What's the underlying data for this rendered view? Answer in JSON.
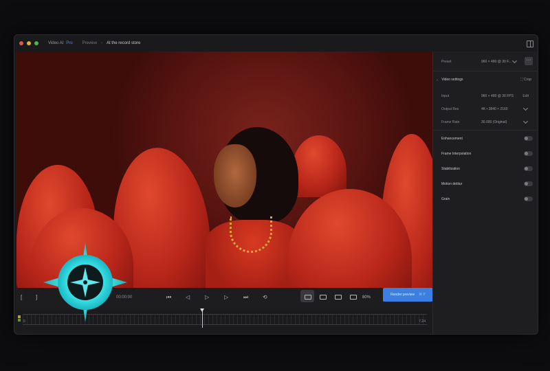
{
  "titlebar": {
    "app_name": "Video AI",
    "app_suffix": "Pro",
    "crumb": "Preview",
    "separator": "›",
    "current_file": "At the record store"
  },
  "controls": {
    "bracket_in": "[",
    "bracket_out": "]",
    "timecode": "00:00:00",
    "zoom": "80%",
    "render_label": "Render preview",
    "render_shortcut": "⌘ P"
  },
  "timeline": {
    "start_label": "0",
    "end_label": "7.24"
  },
  "sidebar": {
    "preset_label": "Preset",
    "preset_value": "960 × 480 @ 30 F...",
    "more": "···",
    "section_title": "Video settings",
    "crop_label": "Crop",
    "input_label": "Input",
    "input_value": "960 × 480 @ 30 FPS",
    "edit_label": "Edit",
    "output_res_label": "Output Res",
    "output_res_value": "4K • 3840 × 2160",
    "frame_rate_label": "Frame Rate",
    "frame_rate_value": "30.000 (Original)",
    "toggles": [
      {
        "label": "Enhancement",
        "on": false
      },
      {
        "label": "Frame Interpolation",
        "on": false
      },
      {
        "label": "Stabilization",
        "on": false
      },
      {
        "label": "Motion deblur",
        "on": false
      },
      {
        "label": "Grain",
        "on": false
      }
    ]
  },
  "colors": {
    "accent": "#3c7fe0",
    "cursor_glow": "#3ee6e8",
    "window_bg": "#1c1c1f"
  }
}
